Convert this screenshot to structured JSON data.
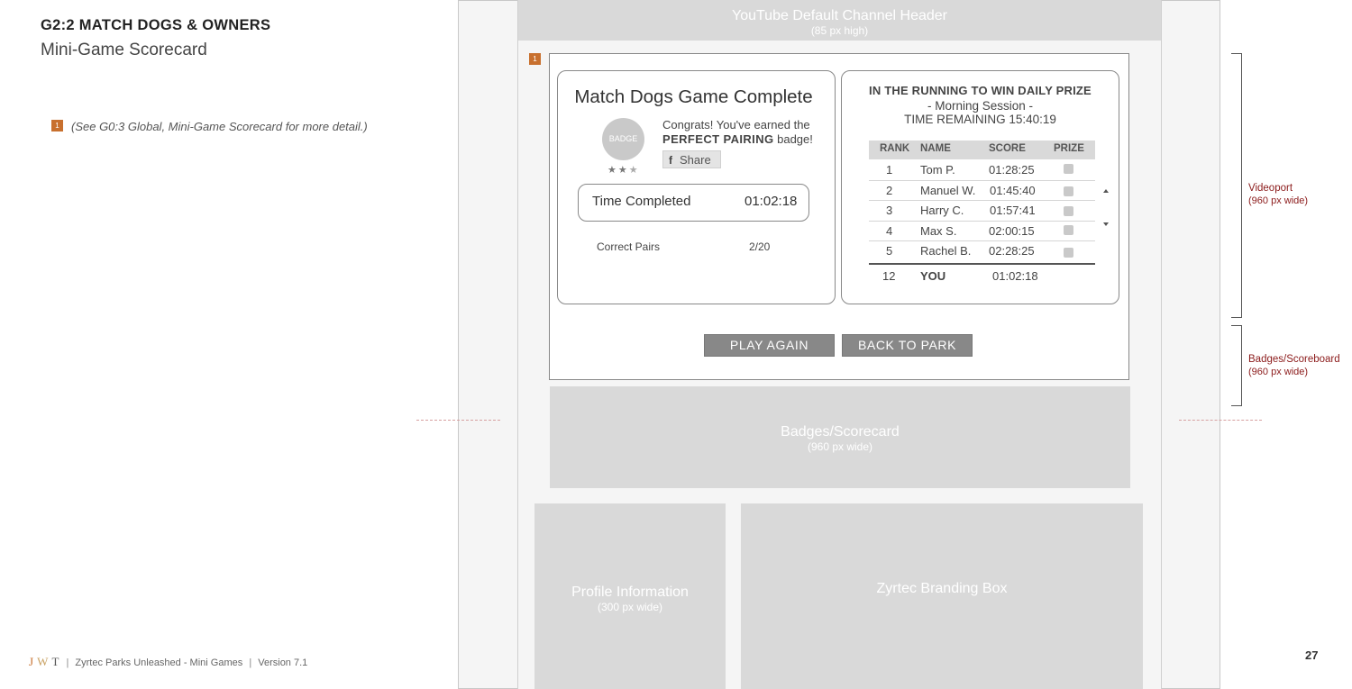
{
  "doc": {
    "title": "G2:2 MATCH DOGS & OWNERS",
    "subtitle": "Mini-Game Scorecard",
    "marker": "1",
    "note": "(See G0:3 Global, Mini-Game Scorecard for more detail.)"
  },
  "footer": {
    "logo_letters": [
      "J",
      "W",
      "T"
    ],
    "project": "Zyrtec Parks Unleashed - Mini Games",
    "version": "Version 7.1",
    "page_number": "27"
  },
  "wireframe": {
    "channel_header": {
      "title": "YouTube Default Channel Header",
      "subtitle": "(85 px high)"
    },
    "marker": "1",
    "game_card": {
      "title": "Match Dogs Game Complete",
      "badge": "BADGE",
      "stars": "★★★",
      "stars_earned": 2,
      "stars_total": 3,
      "congrats_line1": "Congrats! You've earned the",
      "badge_name": "PERFECT PAIRING",
      "badge_suffix": " badge!",
      "share_icon": "f",
      "share_label": "Share",
      "time_label": "Time Completed",
      "time_value": "01:02:18",
      "pairs_label": "Correct Pairs",
      "pairs_value": "2/20"
    },
    "leaderboard": {
      "title": "IN THE RUNNING TO WIN DAILY PRIZE",
      "session": "- Morning Session -",
      "time_remaining": "TIME REMAINING 15:40:19",
      "columns": [
        "RANK",
        "NAME",
        "SCORE",
        "PRIZE"
      ],
      "rows": [
        {
          "rank": "1",
          "name": "Tom P.",
          "score": "01:28:25"
        },
        {
          "rank": "2",
          "name": "Manuel W.",
          "score": "01:45:40"
        },
        {
          "rank": "3",
          "name": "Harry C.",
          "score": "01:57:41"
        },
        {
          "rank": "4",
          "name": "Max S.",
          "score": "02:00:15"
        },
        {
          "rank": "5",
          "name": "Rachel B.",
          "score": "02:28:25"
        }
      ],
      "you": {
        "rank": "12",
        "name": "YOU",
        "score": "01:02:18"
      }
    },
    "buttons": {
      "play_again": "PLAY AGAIN",
      "back_to_park": "BACK TO PARK"
    },
    "scorecard_block": {
      "title": "Badges/Scorecard",
      "subtitle": "(960 px wide)"
    },
    "profile_block": {
      "title": "Profile Information",
      "subtitle": "(300 px wide)"
    },
    "branding_block": {
      "title": "Zyrtec Branding Box"
    }
  },
  "annotations": {
    "videoport": {
      "label": "Videoport",
      "sub": "(960 px wide)"
    },
    "badges": {
      "label": "Badges/Scoreboard",
      "sub": "(960 px wide)"
    }
  },
  "colors": {
    "marker": "#c8702e",
    "annotation": "#8b1a1a",
    "placeholder": "#d9d9d9",
    "button": "#888888"
  }
}
